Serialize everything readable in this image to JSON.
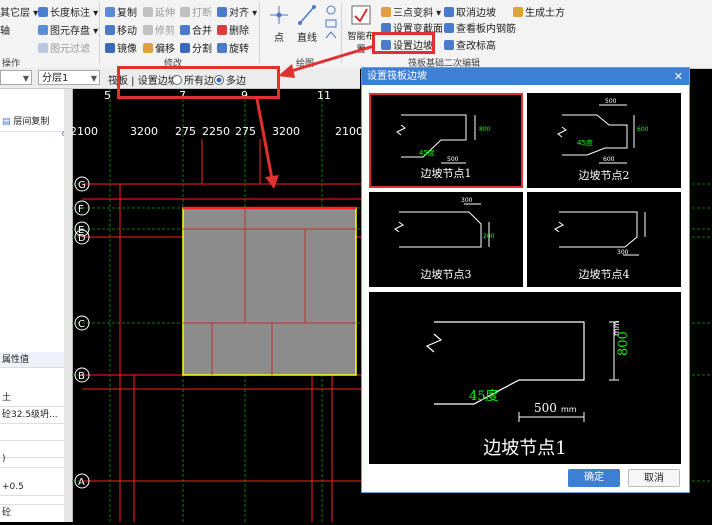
{
  "ribbon": {
    "col1": [
      "其它层",
      "图元存盘",
      "图元过滤"
    ],
    "col1_prefix": "轴",
    "col2": [
      "长度标注",
      "图元存盘",
      "图元过滤"
    ],
    "col3": [
      "复制",
      "移动",
      "镜像"
    ],
    "col4": [
      "延伸",
      "修剪",
      "偏移"
    ],
    "col5": [
      "打断",
      "合并",
      "分割"
    ],
    "col6": [
      "对齐",
      "删除",
      "旋转"
    ],
    "group_ops": "操作",
    "group_modify": "修改",
    "draw_point": "点",
    "draw_line": "直线",
    "draw_group": "绘图",
    "smart_layout": "智能布置",
    "set_slope": "设置边坡",
    "three_point": "三点变斜",
    "set_section": "设置变截面",
    "cancel_slope": "取消边坡",
    "view_rebar": "查看板内钢筋",
    "change_elev": "查改标高",
    "gen_earthwork": "生成土方",
    "group_raft": "筏板基础二次编辑"
  },
  "optbar": {
    "combo_left_value": "",
    "layer_value": "分层1",
    "hint": "筏板 | 设置边坡",
    "all_edges": "所有边",
    "multi_edges": "多边"
  },
  "leftpanel": {
    "floor_copy": "层间复制",
    "prop_value_header": "属性值",
    "rows": [
      "土",
      "砼32.5级坍...",
      "",
      "",
      ")",
      "+0.5",
      "",
      "砼"
    ]
  },
  "grid": {
    "top_axes": [
      "5",
      "7",
      "9",
      "11"
    ],
    "dims": [
      "2100",
      "3200",
      "275",
      "2250",
      "275",
      "3200",
      "2100"
    ],
    "left_axes": [
      "G",
      "F",
      "E",
      "D",
      "C",
      "B",
      "A"
    ]
  },
  "dialog": {
    "title": "设置筏板边坡",
    "nodes": [
      "边坡节点1",
      "边坡节点2",
      "边坡节点3",
      "边坡节点4"
    ],
    "preview_label": "边坡节点1",
    "dim_500": "500",
    "dim_800": "800",
    "dim_600": "600",
    "dim_300": "300",
    "dim_200": "200",
    "unit_mm": "mm",
    "angle": "45度",
    "ok": "确定",
    "cancel": "取消"
  },
  "colors": {
    "accent": "#3c7fd4",
    "highlight": "#e03030",
    "grid_red": "#ff2020",
    "slab_gray": "#8c8c8c",
    "slab_border": "#ffff00"
  }
}
